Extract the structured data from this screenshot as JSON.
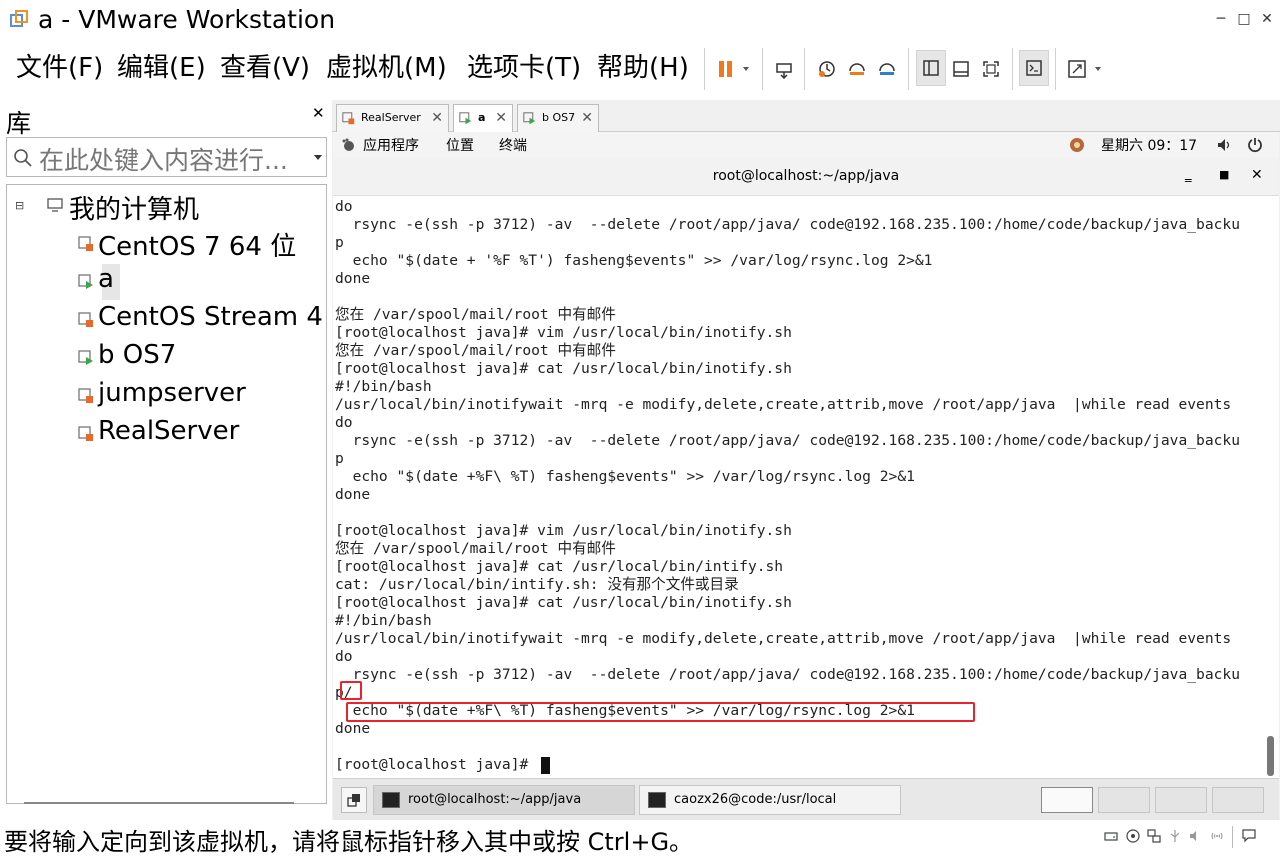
{
  "window": {
    "title": "a - VMware Workstation"
  },
  "menu": [
    "文件(F)",
    "编辑(E)",
    "查看(V)",
    "虚拟机(M)",
    "选项卡(T)",
    "帮助(H)"
  ],
  "library": {
    "title": "库",
    "search_placeholder": "在此处键入内容进行...",
    "root": "我的计算机",
    "items": [
      "CentOS 7 64 位",
      "a",
      "CentOS Stream 4",
      "b OS7",
      "jumpserver",
      "RealServer"
    ]
  },
  "tabs": [
    "RealServer",
    "a",
    "b OS7"
  ],
  "gnome_bar": {
    "apps": "应用程序",
    "places": "位置",
    "terminal": "终端",
    "clock": "星期六 09：17"
  },
  "terminal": {
    "title": "root@localhost:~/app/java",
    "lines": [
      "do",
      "  rsync -e(ssh -p 3712) -av  --delete /root/app/java/ code@192.168.235.100:/home/code/backup/java_backu",
      "p",
      "  echo \"$(date + '%F %T') fasheng$events\" >> /var/log/rsync.log 2>&1",
      "done",
      "",
      "您在 /var/spool/mail/root 中有邮件",
      "[root@localhost java]# vim /usr/local/bin/inotify.sh",
      "您在 /var/spool/mail/root 中有邮件",
      "[root@localhost java]# cat /usr/local/bin/inotify.sh",
      "#!/bin/bash",
      "/usr/local/bin/inotifywait -mrq -e modify,delete,create,attrib,move /root/app/java  |while read events",
      "do",
      "  rsync -e(ssh -p 3712) -av  --delete /root/app/java/ code@192.168.235.100:/home/code/backup/java_backu",
      "p",
      "  echo \"$(date +%F\\ %T) fasheng$events\" >> /var/log/rsync.log 2>&1",
      "done",
      "",
      "[root@localhost java]# vim /usr/local/bin/inotify.sh",
      "您在 /var/spool/mail/root 中有邮件",
      "[root@localhost java]# cat /usr/local/bin/intify.sh",
      "cat: /usr/local/bin/intify.sh: 没有那个文件或目录",
      "[root@localhost java]# cat /usr/local/bin/inotify.sh",
      "#!/bin/bash",
      "/usr/local/bin/inotifywait -mrq -e modify,delete,create,attrib,move /root/app/java  |while read events",
      "do",
      "  rsync -e(ssh -p 3712) -av  --delete /root/app/java/ code@192.168.235.100:/home/code/backup/java_backu",
      "p/",
      "  echo \"$(date +%F\\ %T) fasheng$events\" >> /var/log/rsync.log 2>&1",
      "done",
      "",
      "[root@localhost java]# "
    ]
  },
  "taskbar": {
    "task1": "root@localhost:~/app/java",
    "task2": "caozx26@code:/usr/local"
  },
  "status": {
    "text": "要将输入定向到该虚拟机，请将鼠标指针移入其中或按 Ctrl+G。"
  }
}
